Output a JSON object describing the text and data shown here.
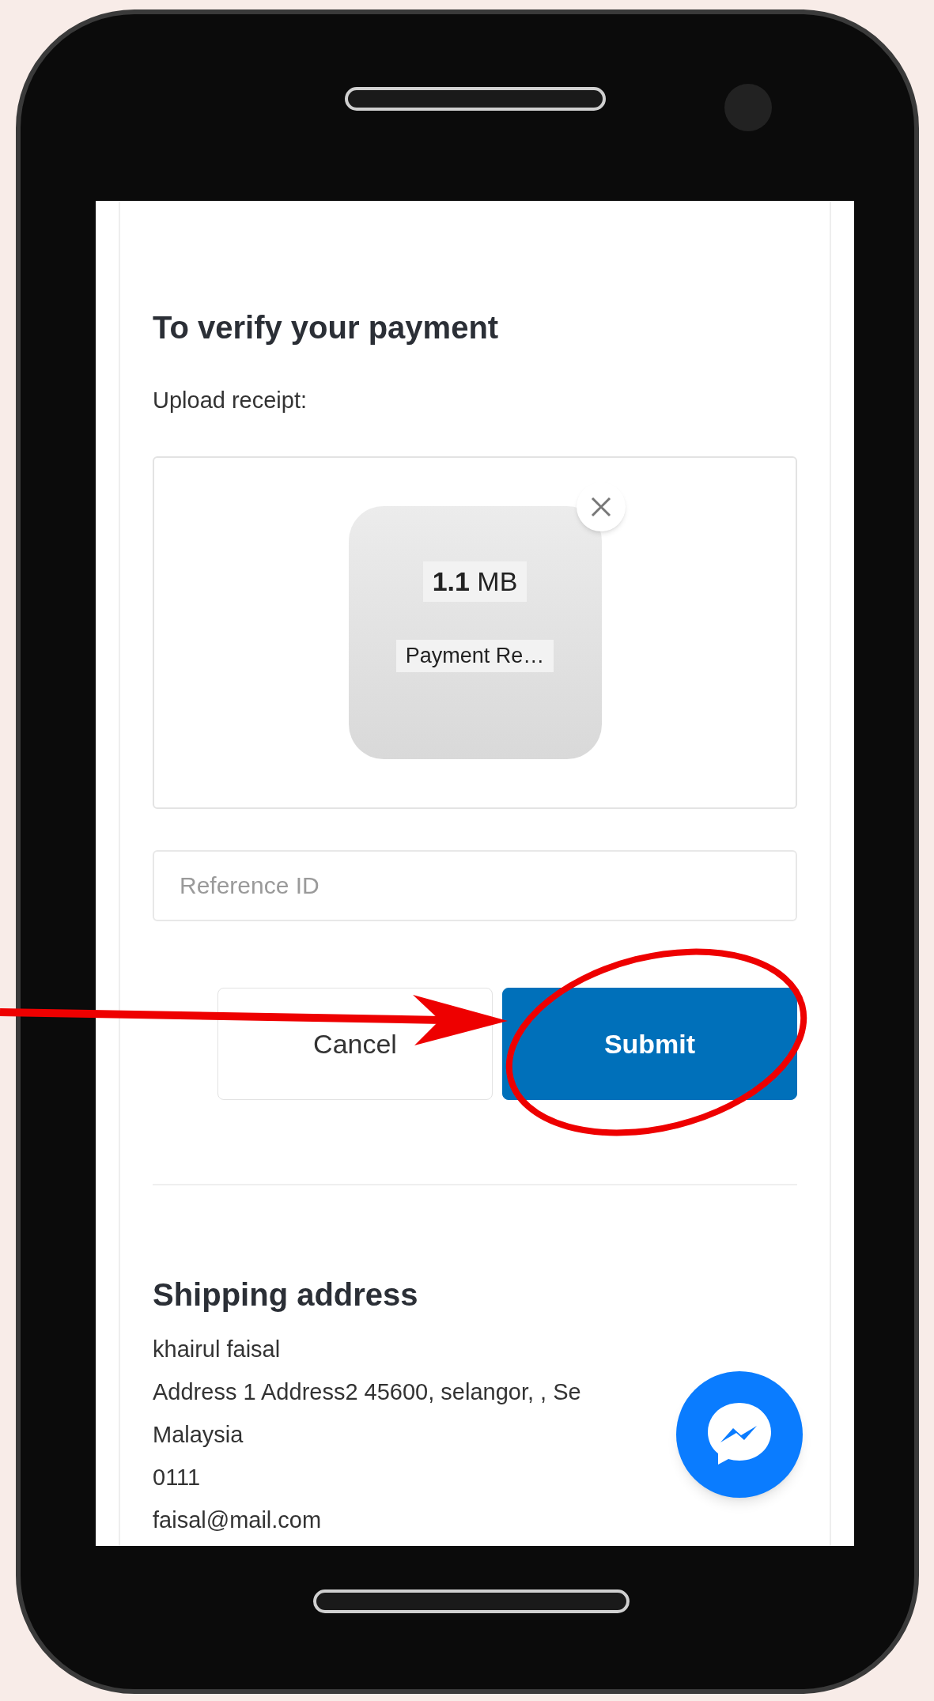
{
  "payment": {
    "heading": "To verify your payment",
    "upload_label": "Upload receipt:",
    "file": {
      "size": "**1.1** MB",
      "name": "Payment Re…"
    },
    "reference_field": {
      "placeholder": "Reference ID"
    },
    "buttons": [
      {
        "label": "Cancel",
        "kind": "secondary"
      },
      {
        "label": "Submit",
        "kind": "primary"
      }
    ]
  },
  "shipping": {
    "heading": "Shipping address",
    "lines": [
      "khairul faisal",
      "Address 1 Address2 45600, selangor, , Se",
      "Malaysia",
      "0111",
      "faisal@mail.com"
    ]
  }
}
